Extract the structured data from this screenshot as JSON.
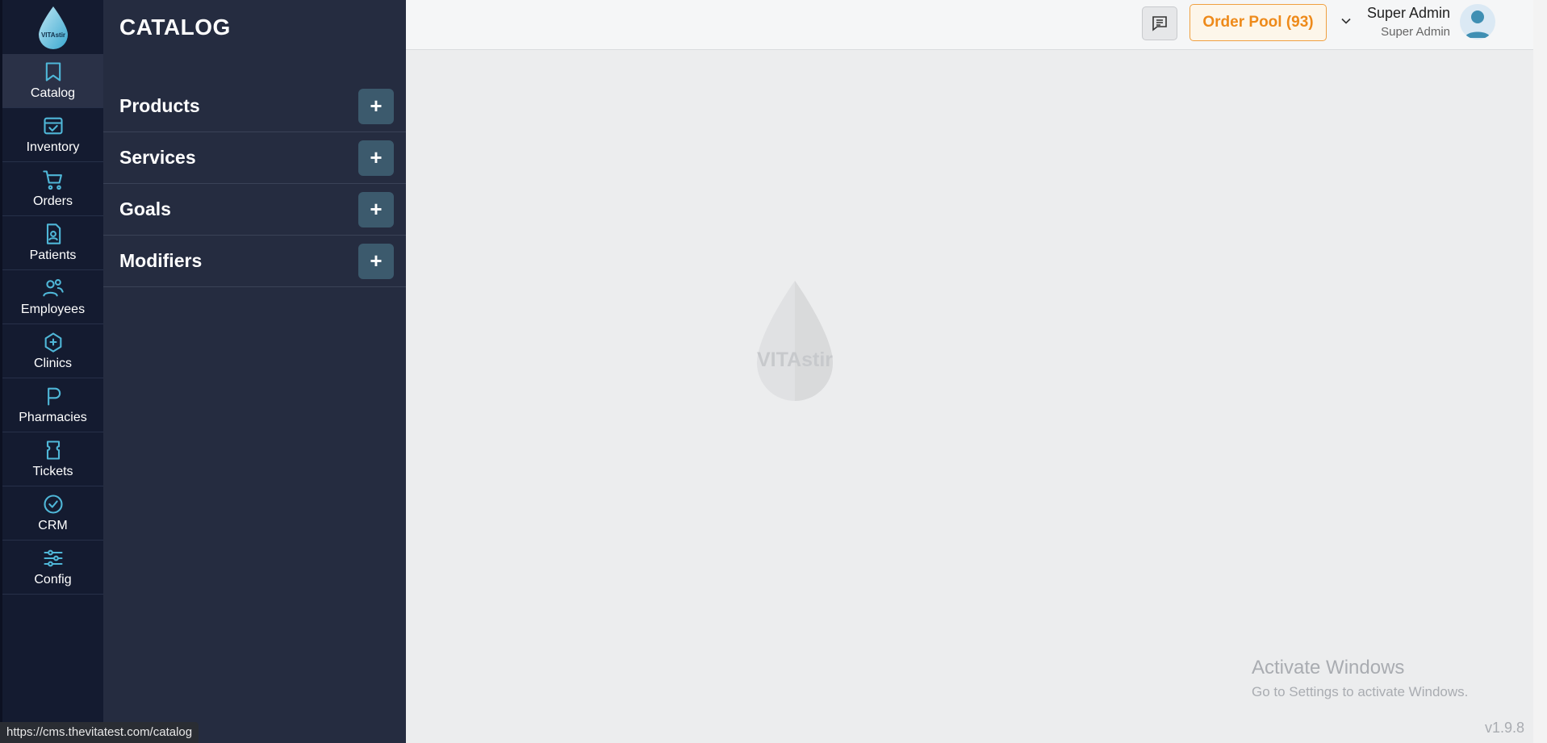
{
  "brand": {
    "logo_text": "VITAstir"
  },
  "rail": {
    "items": [
      {
        "label": "Catalog",
        "icon": "bookmark-icon",
        "active": true
      },
      {
        "label": "Inventory",
        "icon": "inbox-check-icon",
        "active": false
      },
      {
        "label": "Orders",
        "icon": "cart-icon",
        "active": false
      },
      {
        "label": "Patients",
        "icon": "patient-file-icon",
        "active": false
      },
      {
        "label": "Employees",
        "icon": "users-icon",
        "active": false
      },
      {
        "label": "Clinics",
        "icon": "clinic-icon",
        "active": false
      },
      {
        "label": "Pharmacies",
        "icon": "pharmacy-icon",
        "active": false
      },
      {
        "label": "Tickets",
        "icon": "ticket-icon",
        "active": false
      },
      {
        "label": "CRM",
        "icon": "badge-check-icon",
        "active": false
      },
      {
        "label": "Config",
        "icon": "sliders-icon",
        "active": false
      }
    ]
  },
  "panel": {
    "title": "CATALOG",
    "rows": [
      {
        "label": "Products",
        "add": "+"
      },
      {
        "label": "Services",
        "add": "+"
      },
      {
        "label": "Goals",
        "add": "+"
      },
      {
        "label": "Modifiers",
        "add": "+"
      }
    ]
  },
  "header": {
    "order_pool": "Order Pool (93)",
    "user_name": "Super Admin",
    "user_role": "Super Admin"
  },
  "main": {
    "watermark_text": "VITAstir",
    "activate_title": "Activate Windows",
    "activate_sub": "Go to Settings to activate Windows.",
    "version": "v1.9.8"
  },
  "status_bar": {
    "url": "https://cms.thevitatest.com/catalog"
  },
  "colors": {
    "rail_bg": "#141b30",
    "panel_bg": "#252c40",
    "accent_icon": "#4fb7d8",
    "order_pool": "#ee8a1a",
    "plus_btn": "#3c5a6d"
  }
}
